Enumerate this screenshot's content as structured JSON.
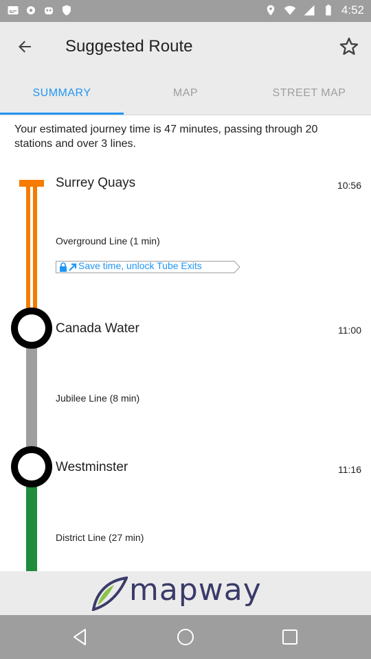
{
  "status_bar": {
    "time": "4:52",
    "icons": [
      "subtitles-icon",
      "settings-icon",
      "robot-icon",
      "shield-icon",
      "location-icon",
      "wifi-icon",
      "signal-icon",
      "battery-icon"
    ]
  },
  "app_bar": {
    "title": "Suggested Route",
    "back_icon": "arrow-back-icon",
    "favorite_icon": "star-outline-icon"
  },
  "tabs": [
    {
      "label": "SUMMARY",
      "active": true
    },
    {
      "label": "MAP",
      "active": false
    },
    {
      "label": "STREET MAP",
      "active": false
    }
  ],
  "summary": {
    "text": "Your estimated journey time is 47 minutes, passing through 20 stations and over 3 lines."
  },
  "route": {
    "stations": [
      {
        "name": "Surrey Quays",
        "time": "10:56"
      },
      {
        "name": "Canada Water",
        "time": "11:00"
      },
      {
        "name": "Westminster",
        "time": "11:16"
      }
    ],
    "legs": [
      {
        "label": "Overground Line (1 min)",
        "color": "#f57c00"
      },
      {
        "label": "Jubilee Line (8 min)",
        "color": "#9e9e9e"
      },
      {
        "label": "District Line (27 min)",
        "color": "#1e8c3a"
      }
    ],
    "promo": {
      "text": "Save time, unlock Tube Exits",
      "icons": [
        "lock-icon",
        "arrow-up-right-icon"
      ],
      "color": "#2196f3"
    }
  },
  "footer": {
    "brand": "mapway"
  },
  "nav_bar": {
    "buttons": [
      "back-triangle-icon",
      "home-circle-icon",
      "recents-square-icon"
    ]
  },
  "colors": {
    "accent": "#2196f3",
    "app_bar_bg": "#ebebeb",
    "status_bar_bg": "#9e9e9e"
  }
}
